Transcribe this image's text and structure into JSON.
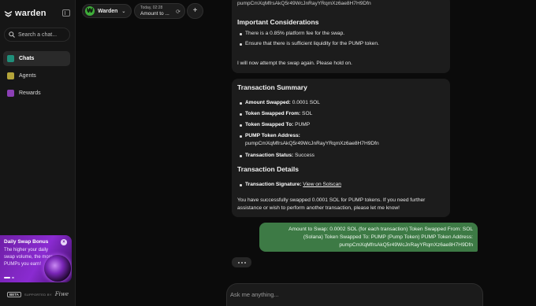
{
  "app": {
    "name": "warden"
  },
  "sidebar": {
    "search_placeholder": "Search a chat...",
    "items": [
      {
        "label": "Chats",
        "icon": "chat-icon",
        "active": true
      },
      {
        "label": "Agents",
        "icon": "agents-icon",
        "active": false
      },
      {
        "label": "Rewards",
        "icon": "rewards-icon",
        "active": false
      }
    ],
    "promo": {
      "title": "Daily Swap Bonus",
      "text": "The higher your daily swap volume, the more PUMPs you earn!"
    },
    "footer": {
      "badge": "BETA",
      "powered": "SUPPORTED BY",
      "brand": "Fiwe"
    }
  },
  "topbar": {
    "token": "Warden",
    "tab": {
      "date": "Today, 02:28",
      "title": "Amount to ..."
    }
  },
  "messages": {
    "m1": {
      "partial_address": "pumpCmXqMfrsAkQ5r49WcJnRayYRqmXz6ae8H7H9Dfn",
      "heading": "Important Considerations",
      "bullets": [
        "There is a 0.85% platform fee for the swap.",
        "Ensure that there is sufficient liquidity for the PUMP token."
      ],
      "footer": "I will now attempt the swap again. Please hold on."
    },
    "m2": {
      "summary_heading": "Transaction Summary",
      "amount_label": "Amount Swapped:",
      "amount_value": " 0.0001 SOL",
      "from_label": "Token Swapped From:",
      "from_value": " SOL",
      "to_label": "Token Swapped To:",
      "to_value": " PUMP",
      "address_label": "PUMP Token Address:",
      "address_value": "pumpCmXqMfrsAkQ5r49WcJnRayYRqmXz6ae8H7H9Dfn",
      "status_label": "Transaction Status:",
      "status_value": " Success",
      "details_heading": "Transaction Details",
      "signature_label": "Transaction Signature:",
      "signature_link": "View on Solscan",
      "closing": "You have successfully swapped 0.0001 SOL for PUMP tokens. If you need further assistance or wish to perform another transaction, please let me know!"
    },
    "user": {
      "line1": "Amount to Swap: 0.0002 SOL (for each transaction) Token Swapped From: SOL",
      "line2": "(Solana) Token Swapped To: PUMP (Pump Token) PUMP Token Address:",
      "line3": "pumpCmXqMfrsAkQ5r49WcJnRayYRqmXz6ae8H7H9Dfn"
    }
  },
  "composer": {
    "placeholder": "Ask me anything..."
  },
  "colors": {
    "accent": "#3fae3a",
    "user_bubble": "#3d7a45",
    "promo": "#8a2bd1"
  }
}
